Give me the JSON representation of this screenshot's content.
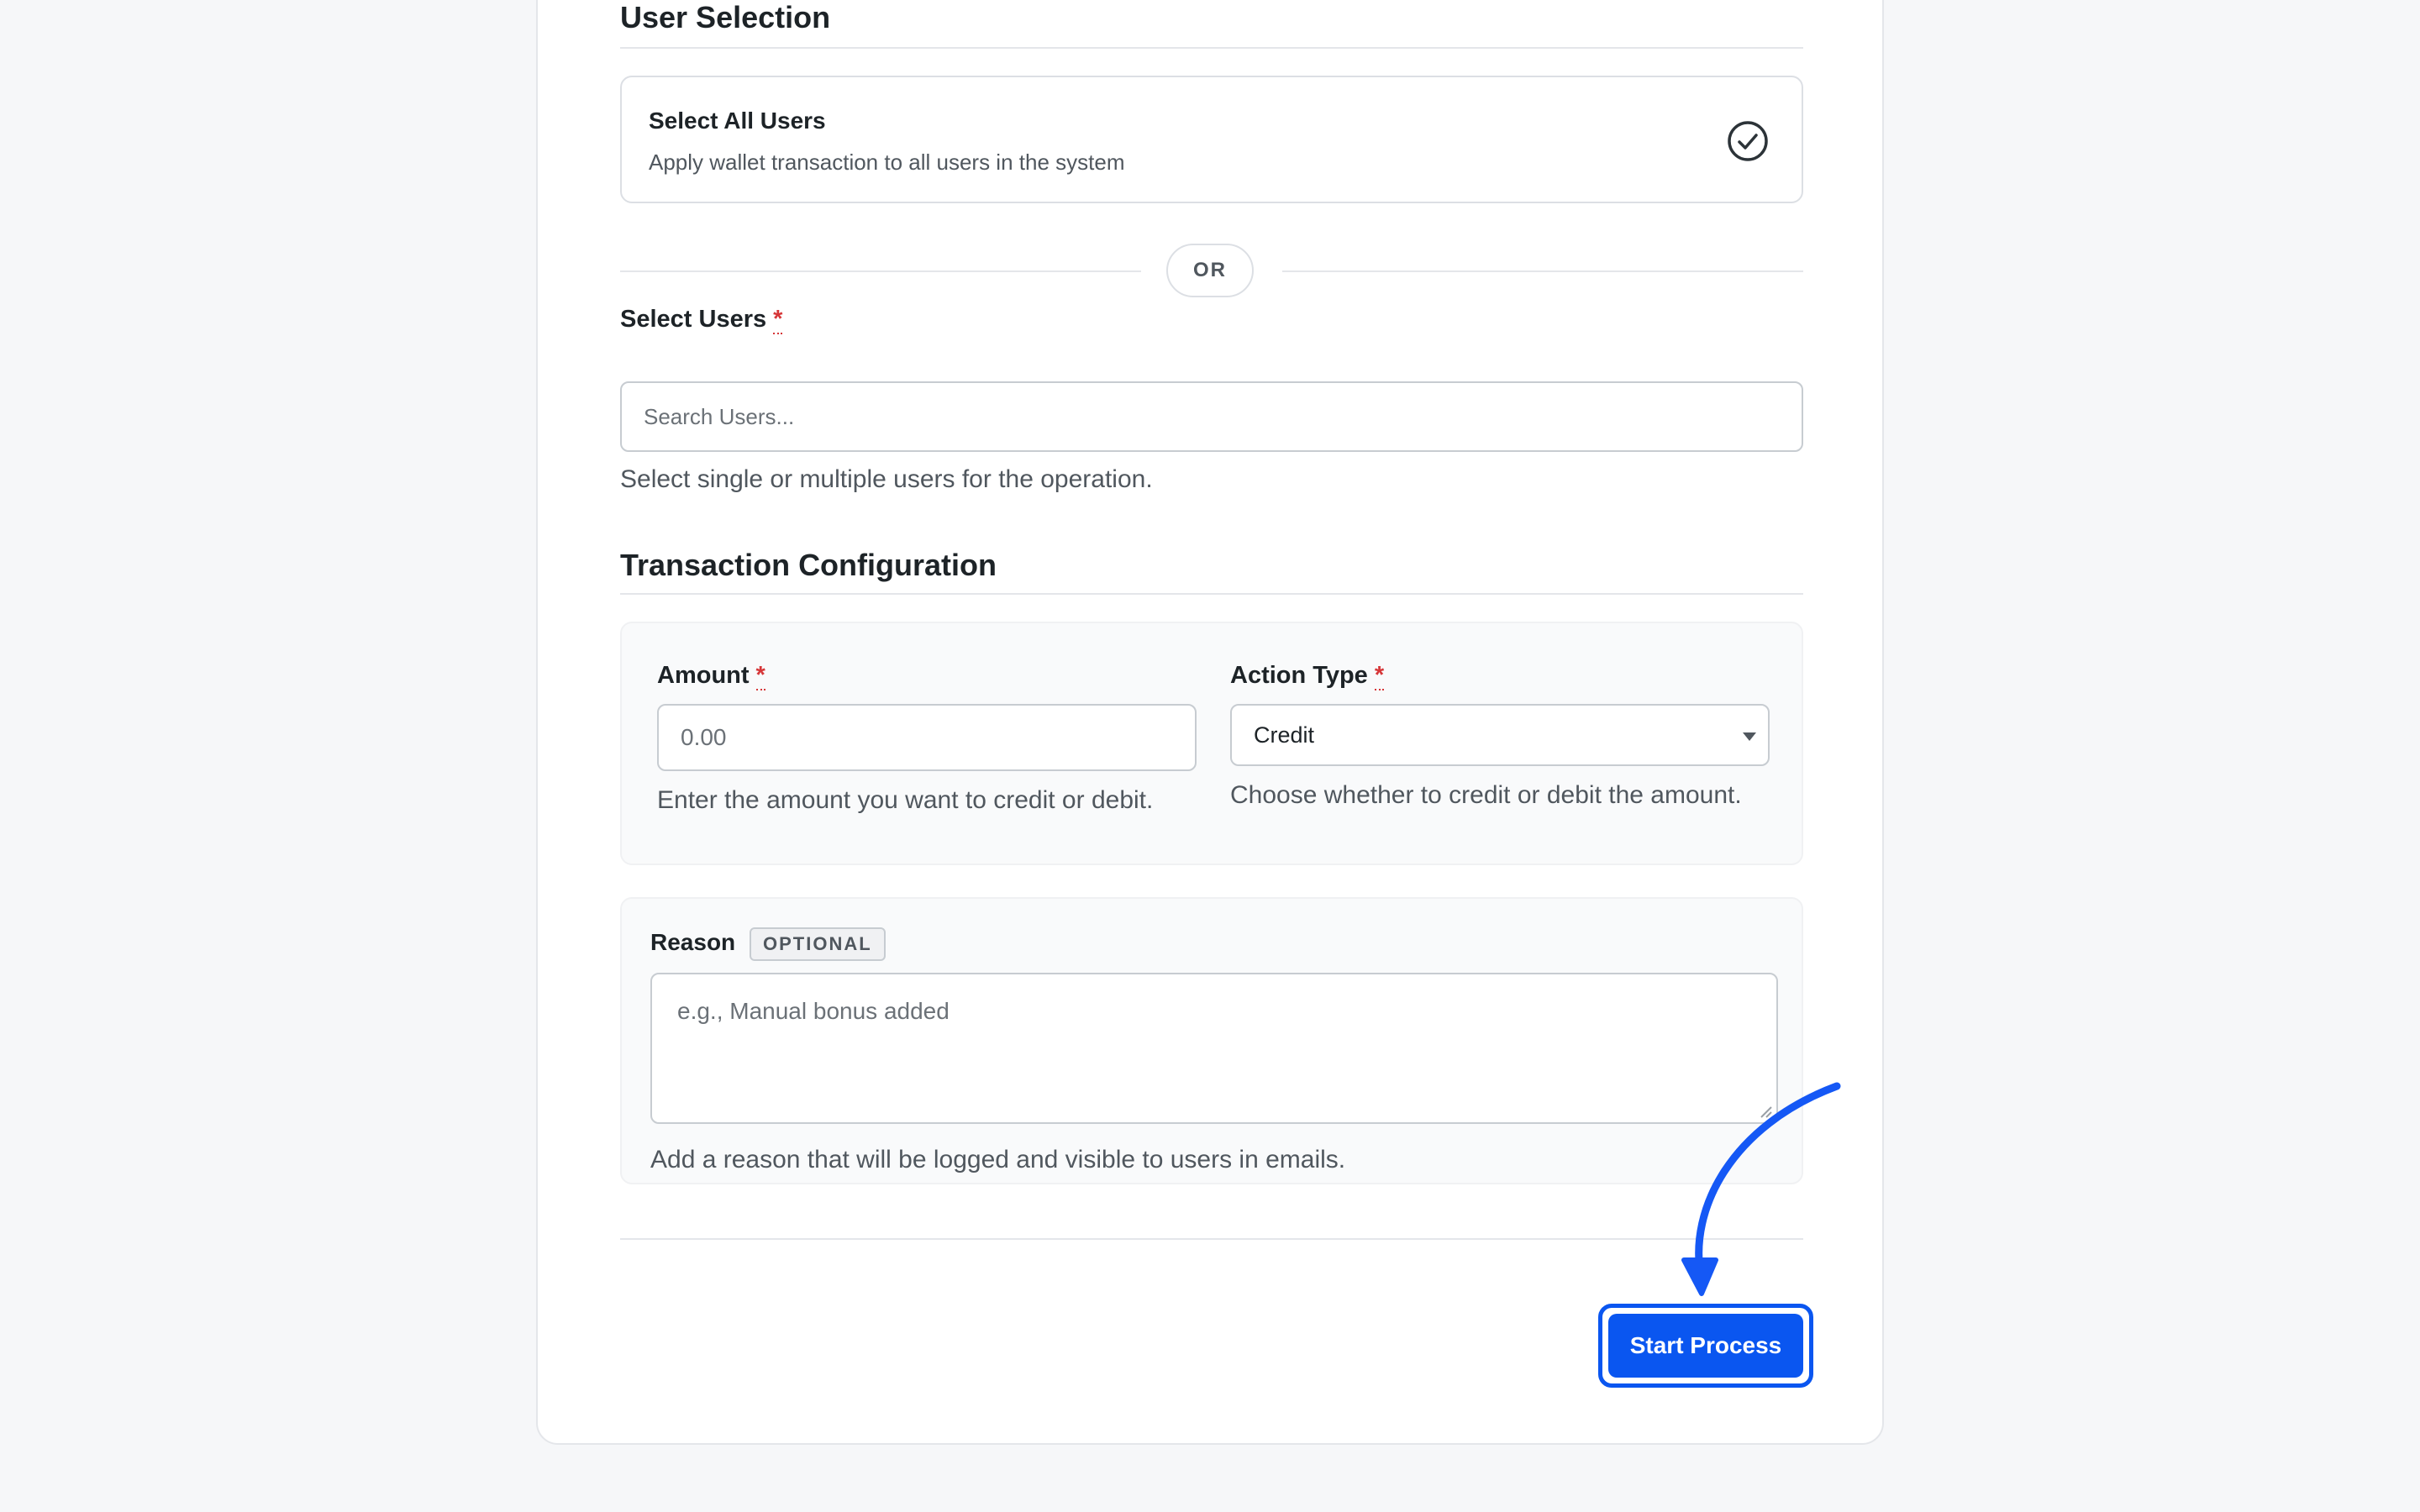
{
  "user_selection": {
    "title": "User Selection",
    "select_all": {
      "label": "Select All Users",
      "description": "Apply wallet transaction to all users in the system"
    },
    "or_label": "OR",
    "select_users": {
      "label": "Select Users",
      "required_mark": "*",
      "placeholder": "Search Users...",
      "help": "Select single or multiple users for the operation."
    }
  },
  "transaction": {
    "title": "Transaction Configuration",
    "amount": {
      "label": "Amount",
      "required_mark": "*",
      "placeholder": "0.00",
      "help": "Enter the amount you want to credit or debit."
    },
    "action_type": {
      "label": "Action Type",
      "required_mark": "*",
      "value": "Credit",
      "help": "Choose whether to credit or debit the amount."
    },
    "reason": {
      "label": "Reason",
      "badge": "OPTIONAL",
      "placeholder": "e.g., Manual bonus added",
      "help": "Add a reason that will be logged and visible to users in emails."
    }
  },
  "actions": {
    "start_label": "Start Process"
  },
  "colors": {
    "primary": "#0a56f0",
    "required": "#d63638",
    "annotation": "#1558f5"
  }
}
